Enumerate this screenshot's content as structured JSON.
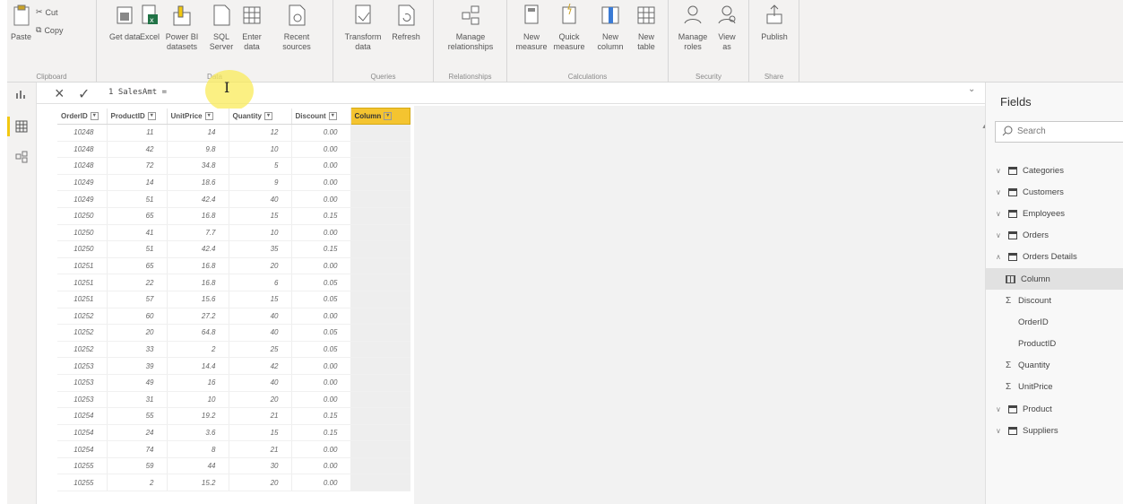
{
  "ribbon": {
    "clipboard": {
      "label": "Clipboard",
      "paste": "Paste",
      "cut": "Cut",
      "copy": "Copy"
    },
    "data": {
      "label": "Data",
      "get_data": "Get data",
      "excel": "Excel",
      "power_bi": "Power BI datasets",
      "sql": "SQL Server",
      "enter_data": "Enter data",
      "recent": "Recent sources"
    },
    "queries": {
      "label": "Queries",
      "transform": "Transform data",
      "refresh": "Refresh"
    },
    "relationships": {
      "label": "Relationships",
      "manage": "Manage relationships"
    },
    "calculations": {
      "label": "Calculations",
      "new_measure": "New measure",
      "quick_measure": "Quick measure",
      "new_column": "New column",
      "new_table": "New table"
    },
    "security": {
      "label": "Security",
      "manage_roles": "Manage roles",
      "view_as": "View as"
    },
    "share": {
      "label": "Share",
      "publish": "Publish"
    }
  },
  "formula": {
    "text": "1 SalesAmt ="
  },
  "table": {
    "columns": [
      "OrderID",
      "ProductID",
      "UnitPrice",
      "Quantity",
      "Discount",
      "Column"
    ],
    "rows": [
      [
        "10248",
        "11",
        "14",
        "12",
        "0.00"
      ],
      [
        "10248",
        "42",
        "9.8",
        "10",
        "0.00"
      ],
      [
        "10248",
        "72",
        "34.8",
        "5",
        "0.00"
      ],
      [
        "10249",
        "14",
        "18.6",
        "9",
        "0.00"
      ],
      [
        "10249",
        "51",
        "42.4",
        "40",
        "0.00"
      ],
      [
        "10250",
        "65",
        "16.8",
        "15",
        "0.15"
      ],
      [
        "10250",
        "41",
        "7.7",
        "10",
        "0.00"
      ],
      [
        "10250",
        "51",
        "42.4",
        "35",
        "0.15"
      ],
      [
        "10251",
        "65",
        "16.8",
        "20",
        "0.00"
      ],
      [
        "10251",
        "22",
        "16.8",
        "6",
        "0.05"
      ],
      [
        "10251",
        "57",
        "15.6",
        "15",
        "0.05"
      ],
      [
        "10252",
        "60",
        "27.2",
        "40",
        "0.00"
      ],
      [
        "10252",
        "20",
        "64.8",
        "40",
        "0.05"
      ],
      [
        "10252",
        "33",
        "2",
        "25",
        "0.05"
      ],
      [
        "10253",
        "39",
        "14.4",
        "42",
        "0.00"
      ],
      [
        "10253",
        "49",
        "16",
        "40",
        "0.00"
      ],
      [
        "10253",
        "31",
        "10",
        "20",
        "0.00"
      ],
      [
        "10254",
        "55",
        "19.2",
        "21",
        "0.15"
      ],
      [
        "10254",
        "24",
        "3.6",
        "15",
        "0.15"
      ],
      [
        "10254",
        "74",
        "8",
        "21",
        "0.00"
      ],
      [
        "10255",
        "59",
        "44",
        "30",
        "0.00"
      ],
      [
        "10255",
        "2",
        "15.2",
        "20",
        "0.00"
      ]
    ]
  },
  "fields": {
    "title": "Fields",
    "search_placeholder": "Search",
    "tables": [
      {
        "name": "Categories",
        "expanded": false
      },
      {
        "name": "Customers",
        "expanded": false
      },
      {
        "name": "Employees",
        "expanded": false
      },
      {
        "name": "Orders",
        "expanded": false
      },
      {
        "name": "Orders Details",
        "expanded": true
      },
      {
        "name": "Product",
        "expanded": false
      },
      {
        "name": "Suppliers",
        "expanded": false
      }
    ],
    "order_details_fields": [
      {
        "name": "Column",
        "kind": "column",
        "selected": true
      },
      {
        "name": "Discount",
        "kind": "sum"
      },
      {
        "name": "OrderID",
        "kind": "plain"
      },
      {
        "name": "ProductID",
        "kind": "plain"
      },
      {
        "name": "Quantity",
        "kind": "sum"
      },
      {
        "name": "UnitPrice",
        "kind": "sum"
      }
    ]
  },
  "colors": {
    "accent_yellow": "#f4c430",
    "ribbon_bg": "#f3f2f1",
    "excel_green": "#217346"
  }
}
